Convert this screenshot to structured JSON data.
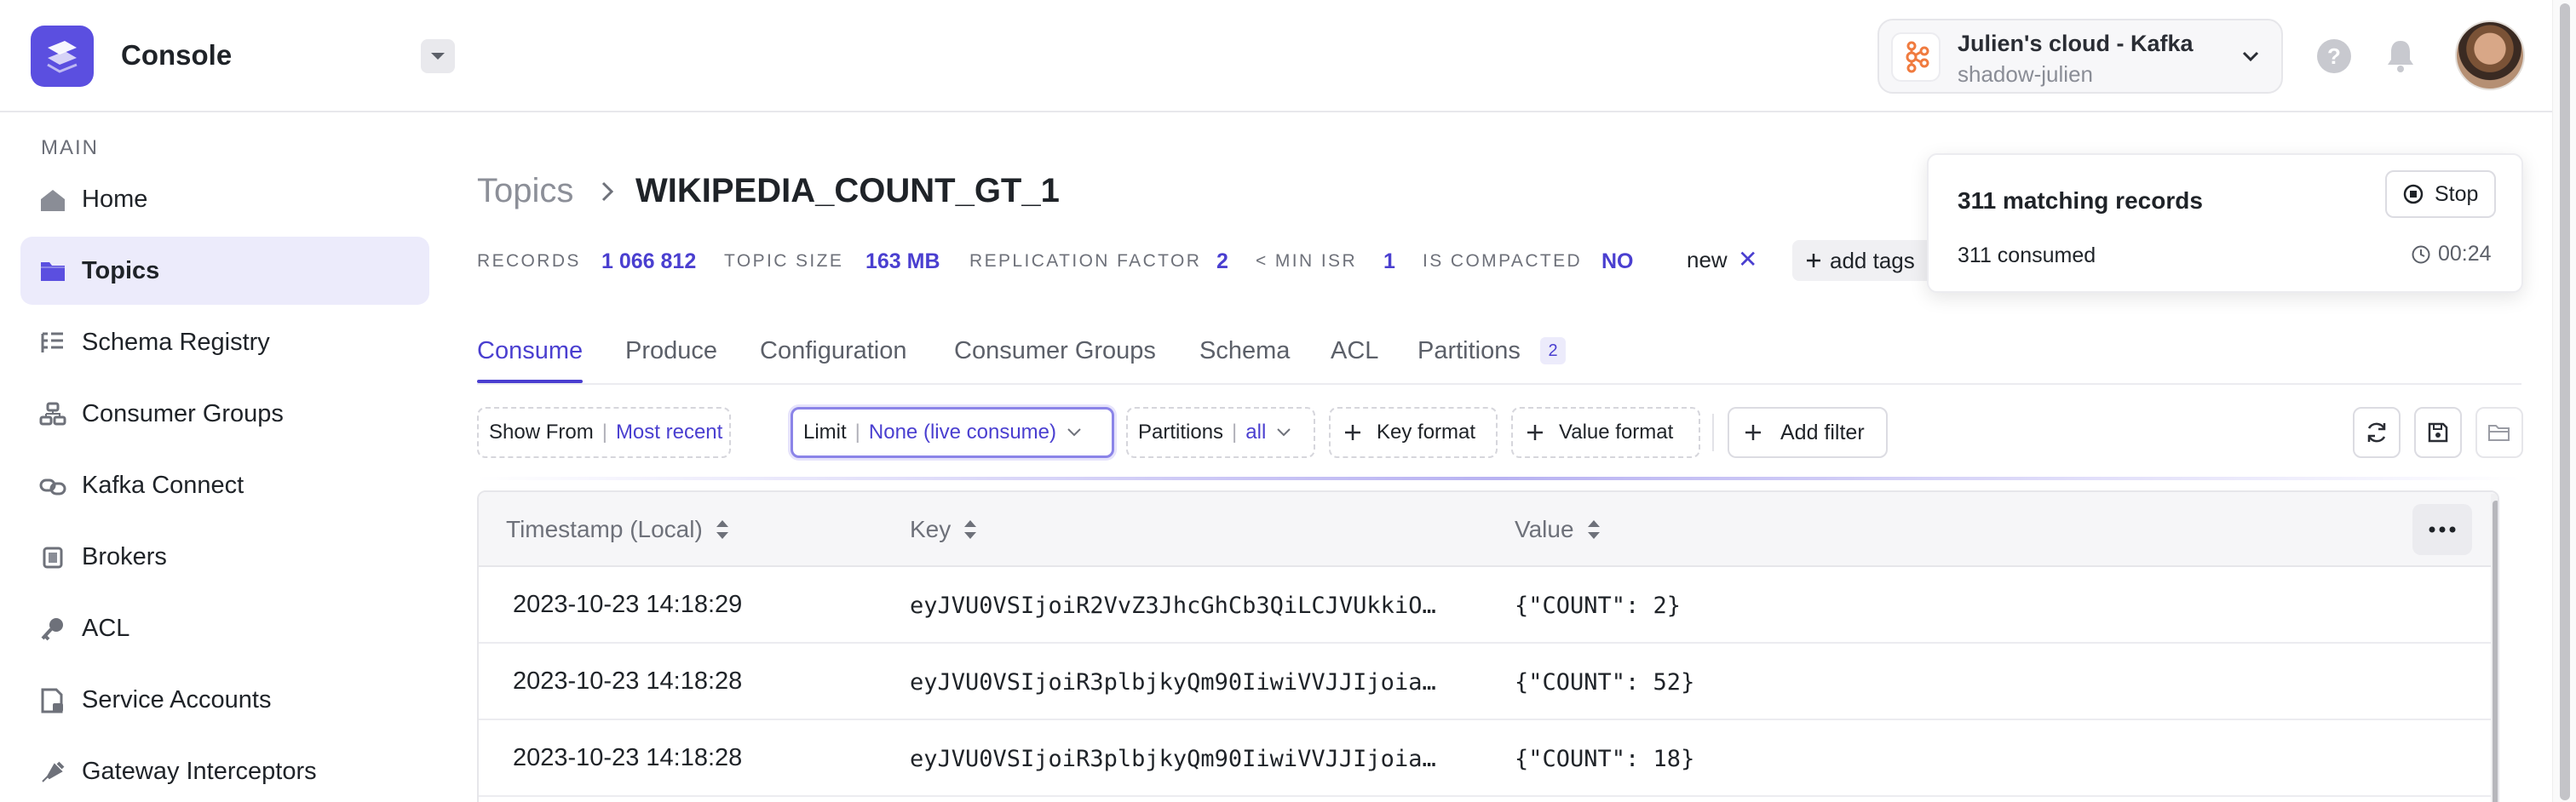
{
  "app": {
    "title": "Console",
    "logo_color": "#5b4fe0",
    "accent": "#4a3fd0"
  },
  "cluster": {
    "name": "Julien's cloud - Kafka",
    "sub": "shadow-julien",
    "icon": "kafka-icon"
  },
  "header_icons": {
    "help": "?",
    "notifications": "bell-icon"
  },
  "sidebar": {
    "section": "MAIN",
    "items": [
      {
        "label": "Home",
        "icon": "home-icon"
      },
      {
        "label": "Topics",
        "icon": "topics-icon",
        "active": true
      },
      {
        "label": "Schema Registry",
        "icon": "schema-registry-icon"
      },
      {
        "label": "Consumer Groups",
        "icon": "consumer-groups-icon"
      },
      {
        "label": "Kafka Connect",
        "icon": "kafka-connect-icon"
      },
      {
        "label": "Brokers",
        "icon": "brokers-icon"
      },
      {
        "label": "ACL",
        "icon": "acl-key-icon"
      },
      {
        "label": "Service Accounts",
        "icon": "service-accounts-icon"
      },
      {
        "label": "Gateway Interceptors",
        "icon": "gateway-interceptors-icon"
      }
    ]
  },
  "breadcrumb": {
    "parent": "Topics",
    "current": "WIKIPEDIA_COUNT_GT_1"
  },
  "stats": {
    "records_label": "RECORDS",
    "records": "1 066 812",
    "size_label": "TOPIC SIZE",
    "size": "163 MB",
    "repl_label": "REPLICATION FACTOR",
    "repl": "2",
    "isr_label": "< MIN ISR",
    "isr": "1",
    "compacted_label": "IS COMPACTED",
    "compacted": "NO"
  },
  "tags": {
    "items": [
      "new"
    ],
    "remove": "✕",
    "add_label": "add tags"
  },
  "tabs": [
    "Consume",
    "Produce",
    "Configuration",
    "Consumer Groups",
    "Schema",
    "ACL",
    "Partitions"
  ],
  "partitions_count": "2",
  "filters": {
    "show_from": {
      "label": "Show From",
      "value": "Most recent"
    },
    "limit": {
      "label": "Limit",
      "value": "None (live consume)"
    },
    "partitions": {
      "label": "Partitions",
      "value": "all"
    },
    "key_format": "Key format",
    "value_format": "Value format",
    "add_filter": "Add filter"
  },
  "table": {
    "headers": [
      "Timestamp (Local)",
      "Key",
      "Value"
    ],
    "rows": [
      {
        "timestamp": "2023-10-23 14:18:29",
        "key": "eyJVU0VSIjoiR2VvZ3JhcGhCb3QiLCJVUkkiO…",
        "value": "{\"COUNT\": 2}"
      },
      {
        "timestamp": "2023-10-23 14:18:28",
        "key": "eyJVU0VSIjoiR3plbjkyQm90IiwiVVJJIjoia…",
        "value": "{\"COUNT\": 52}"
      },
      {
        "timestamp": "2023-10-23 14:18:28",
        "key": "eyJVU0VSIjoiR3plbjkyQm90IiwiVVJJIjoia…",
        "value": "{\"COUNT\": 18}"
      }
    ]
  },
  "popover": {
    "matching": "311 matching records",
    "stop_label": "Stop",
    "consumed": "311 consumed",
    "elapsed": "00:24"
  }
}
